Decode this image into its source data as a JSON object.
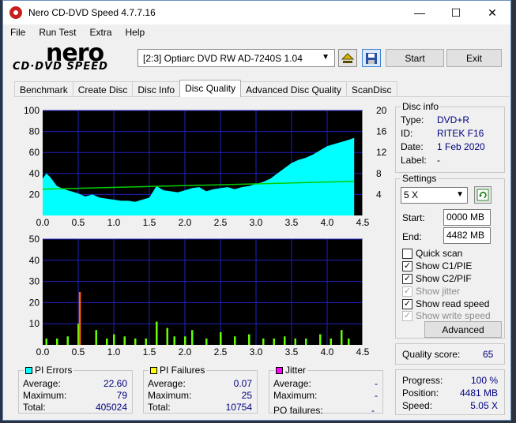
{
  "window": {
    "title": "Nero CD-DVD Speed 4.7.7.16",
    "minimize": "—",
    "maximize": "☐",
    "close": "✕"
  },
  "menu": [
    "File",
    "Run Test",
    "Extra",
    "Help"
  ],
  "logo": {
    "line1": "nero",
    "line2": "CD·DVD SPEED"
  },
  "toolbar": {
    "drive": "[2:3]   Optiarc DVD RW AD-7240S 1.04",
    "start": "Start",
    "exit": "Exit",
    "icons": [
      "eject-icon",
      "save-icon"
    ]
  },
  "tabs": [
    "Benchmark",
    "Create Disc",
    "Disc Info",
    "Disc Quality",
    "Advanced Disc Quality",
    "ScanDisc"
  ],
  "active_tab": "Disc Quality",
  "disc_info": {
    "title": "Disc info",
    "type_label": "Type:",
    "type": "DVD+R",
    "id_label": "ID:",
    "id": "RITEK F16",
    "date_label": "Date:",
    "date": "1 Feb 2020",
    "label_label": "Label:",
    "label": "-"
  },
  "settings": {
    "title": "Settings",
    "speed": "5 X",
    "start_label": "Start:",
    "start": "0000 MB",
    "end_label": "End:",
    "end": "4482 MB",
    "quick_scan": "Quick scan",
    "show_c1": "Show C1/PIE",
    "show_c2": "Show C2/PIF",
    "show_jitter": "Show jitter",
    "show_read": "Show read speed",
    "show_write": "Show write speed",
    "advanced": "Advanced"
  },
  "quality": {
    "label": "Quality score:",
    "value": "65"
  },
  "progress": {
    "progress_label": "Progress:",
    "progress": "100 %",
    "position_label": "Position:",
    "position": "4481 MB",
    "speed_label": "Speed:",
    "speed": "5.05 X"
  },
  "pi_errors": {
    "title": "PI Errors",
    "color": "#00ffff",
    "average_label": "Average:",
    "average": "22.60",
    "maximum_label": "Maximum:",
    "maximum": "79",
    "total_label": "Total:",
    "total": "405024"
  },
  "pi_failures": {
    "title": "PI Failures",
    "color": "#ffff00",
    "average_label": "Average:",
    "average": "0.07",
    "maximum_label": "Maximum:",
    "maximum": "25",
    "total_label": "Total:",
    "total": "10754"
  },
  "jitter": {
    "title": "Jitter",
    "color": "#ff00ff",
    "average_label": "Average:",
    "average": "-",
    "maximum_label": "Maximum:",
    "maximum": "-",
    "po_label": "PO failures:",
    "po": "-"
  },
  "chart_data": [
    {
      "type": "area",
      "x_ticks": [
        "0.0",
        "0.5",
        "1.0",
        "1.5",
        "2.0",
        "2.5",
        "3.0",
        "3.5",
        "4.0",
        "4.5"
      ],
      "y_ticks_left": [
        "100",
        "80",
        "60",
        "40",
        "20"
      ],
      "y_ticks_right": [
        "20",
        "16",
        "12",
        "8",
        "4"
      ],
      "xlim": [
        0,
        4.5
      ],
      "ylim": [
        0,
        100
      ],
      "y2lim": [
        0,
        20
      ],
      "series": [
        {
          "color": "#00ffff",
          "x": [
            0.0,
            0.05,
            0.1,
            0.2,
            0.3,
            0.4,
            0.5,
            0.6,
            0.7,
            0.8,
            0.9,
            1.0,
            1.1,
            1.2,
            1.3,
            1.4,
            1.5,
            1.6,
            1.7,
            1.8,
            1.9,
            2.0,
            2.1,
            2.2,
            2.3,
            2.4,
            2.5,
            2.6,
            2.7,
            2.8,
            2.9,
            3.0,
            3.1,
            3.2,
            3.3,
            3.4,
            3.5,
            3.6,
            3.7,
            3.8,
            3.9,
            4.0,
            4.1,
            4.2,
            4.3,
            4.38
          ],
          "values": [
            35,
            40,
            37,
            28,
            25,
            23,
            21,
            18,
            20,
            17,
            16,
            15,
            14,
            14,
            13,
            15,
            17,
            28,
            24,
            23,
            22,
            24,
            26,
            27,
            23,
            25,
            26,
            27,
            25,
            27,
            28,
            30,
            32,
            35,
            40,
            45,
            50,
            53,
            55,
            58,
            62,
            66,
            68,
            70,
            72,
            74
          ]
        },
        {
          "color": "#00d000",
          "x": [
            0.0,
            4.38
          ],
          "values": [
            5.0,
            6.5
          ]
        }
      ]
    },
    {
      "type": "bar",
      "x_ticks": [
        "0.0",
        "0.5",
        "1.0",
        "1.5",
        "2.0",
        "2.5",
        "3.0",
        "3.5",
        "4.0",
        "4.5"
      ],
      "y_ticks_left": [
        "50",
        "40",
        "30",
        "20",
        "10"
      ],
      "xlim": [
        0,
        4.5
      ],
      "ylim": [
        0,
        50
      ],
      "series": [
        {
          "color": "#66ff00",
          "x": [
            0.05,
            0.2,
            0.35,
            0.5,
            0.52,
            0.75,
            0.9,
            1.0,
            1.15,
            1.3,
            1.45,
            1.6,
            1.75,
            1.85,
            2.0,
            2.1,
            2.3,
            2.5,
            2.7,
            2.9,
            3.1,
            3.25,
            3.4,
            3.55,
            3.7,
            3.9,
            4.05,
            4.2,
            4.3
          ],
          "values": [
            3,
            3,
            4,
            10,
            25,
            7,
            3,
            5,
            4,
            3,
            3,
            11,
            8,
            4,
            4,
            7,
            3,
            6,
            4,
            5,
            3,
            3,
            4,
            3,
            3,
            5,
            3,
            7,
            3
          ]
        }
      ]
    }
  ]
}
